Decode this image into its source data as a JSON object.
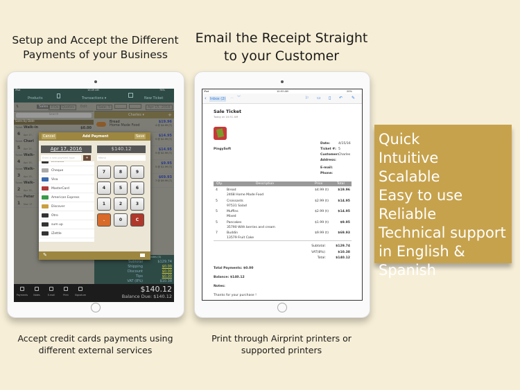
{
  "headings": {
    "left": [
      "Setup and Accept the Different",
      "Payments of your Business"
    ],
    "center": [
      "Email the Receipt Straight",
      "to your Customer"
    ]
  },
  "captions": {
    "left": [
      "Accept credit cards payments using",
      "different external services"
    ],
    "right": [
      "Print through Airprint printers or",
      "supported printers"
    ]
  },
  "features": [
    "Quick",
    "Intuitive",
    "Scalable",
    "Easy to use",
    "Reliable",
    "Technical support",
    "in English & Spanish"
  ],
  "colors": {
    "background": "#f6eed6",
    "feature_box": "#c6a24c",
    "pos_nav": "#2e4a45",
    "modal_header": "#9c8640"
  },
  "pos": {
    "status": {
      "carrier": "iPad",
      "time": "10:49 AM",
      "battery": "76%"
    },
    "nav": {
      "products": "Products",
      "transactions": "Transactions ▾",
      "new_ticket": "New Ticket"
    },
    "segments": [
      "Sales",
      "P.Os",
      "Quotes"
    ],
    "edit": "Edit",
    "search": "Search",
    "sale_label": "Sale: 5",
    "ticket_date": "Apr 15, 2016",
    "customer": "Charles ▾",
    "section": "Sales by Date",
    "tickets": [
      {
        "label": "Ticket",
        "name": "Walk-in",
        "num": "6",
        "date": "Apr 17,",
        "amount": "$0.00"
      },
      {
        "label": "Ticket",
        "name": "Charl",
        "num": "5",
        "date": "Apr 15,"
      },
      {
        "label": "Ticket",
        "name": "Walk-",
        "num": "4",
        "date": "Apr 15,"
      },
      {
        "label": "Ticket",
        "name": "Walk-",
        "num": "3",
        "date": "Apr 15,"
      },
      {
        "label": "Ticket",
        "name": "Walk-",
        "num": "2",
        "date": "Apr 15,"
      },
      {
        "label": "Ticket",
        "name": "Peter",
        "num": "1",
        "date": "Nov 17"
      }
    ],
    "items": [
      {
        "name": "Bread",
        "desc": "Home Made Food",
        "total": "$19.96",
        "qty": "4 @ $4.99 (T)"
      },
      {
        "total": "$14.95",
        "qty": "5 @ $2.99 (T)"
      },
      {
        "total": "$14.95",
        "qty": "5 @ $2.99 (T)"
      },
      {
        "total": "$9.95",
        "qty": "5 @ $1.99 (T)"
      },
      {
        "total": "$69.93",
        "qty": "7 @ $9.99 (T)"
      }
    ],
    "modal": {
      "cancel": "Cancel",
      "title": "Add Payment",
      "save": "Save",
      "date": "Apr 17, 2016",
      "amount": "$140.12",
      "type_placeholder": "Enter a new payment type",
      "add": "+",
      "memo_placeholder": "Memo",
      "methods": [
        "Efectivo",
        "Cheque",
        "Visa",
        "MasterCard",
        "American Express",
        "Discover",
        "Otro",
        "sum up",
        "iZettle"
      ],
      "keys": [
        "7",
        "8",
        "9",
        "4",
        "5",
        "6",
        "1",
        "2",
        "3",
        ".",
        "0",
        "C"
      ]
    },
    "notes": "Notes (0)",
    "totals": [
      [
        "Subtotal",
        "$129.74"
      ],
      [
        "Shipping",
        "$0.00"
      ],
      [
        "Discount",
        "$0.00"
      ],
      [
        "Tips",
        "$0.00"
      ],
      [
        "VAT (8%)",
        "$10.38"
      ]
    ],
    "toolbar": [
      "Payments",
      "Notes",
      "E-mail",
      "Print",
      "Signature"
    ],
    "grand_total": "$140.12",
    "balance_due": "Balance Due: $140.12"
  },
  "mail": {
    "status": {
      "carrier": "iPad",
      "time": "10:53 AM",
      "battery": "20%"
    },
    "inbox": "Inbox (2)",
    "subject": "Sale Ticket",
    "received": "Today at 10:51 AM",
    "company": "PingySoft",
    "meta": [
      [
        "Date:",
        "4/15/16"
      ],
      [
        "Ticket #:",
        "5"
      ],
      [
        "Customer:",
        "Charles"
      ],
      [
        "Address:",
        ""
      ],
      [
        "E-mail:",
        ""
      ],
      [
        "Phone:",
        ""
      ]
    ],
    "columns": [
      "Qty.",
      "Description",
      "Price",
      "Total"
    ],
    "rows": [
      {
        "qty": "4",
        "desc": "Bread",
        "sub": "2468 Home Made Food",
        "price": "$4.99 (t)",
        "total": "$19.96"
      },
      {
        "qty": "5",
        "desc": "Croissants",
        "sub": "97531 Salad",
        "price": "$2.99 (t)",
        "total": "$14.95"
      },
      {
        "qty": "5",
        "desc": "Muffins",
        "sub": "Mixed",
        "price": "$2.99 (t)",
        "total": "$14.95"
      },
      {
        "qty": "5",
        "desc": "Pancakes",
        "sub": "35790 With berries and cream",
        "price": "$1.99 (t)",
        "total": "$9.95"
      },
      {
        "qty": "7",
        "desc": "Buddin",
        "sub": "13579 Fruit Cake",
        "price": "$9.99 (t)",
        "total": "$69.93"
      }
    ],
    "summary": [
      [
        "Subtotal:",
        "$129.74"
      ],
      [
        "VAT(8%):",
        "$10.38"
      ],
      [
        "Total:",
        "$140.12"
      ]
    ],
    "total_payments": "Total Payments: $0.00",
    "balance": "Balance: $140.12",
    "notes": "Notes:",
    "thanks": "Thanks for your purchase !"
  }
}
